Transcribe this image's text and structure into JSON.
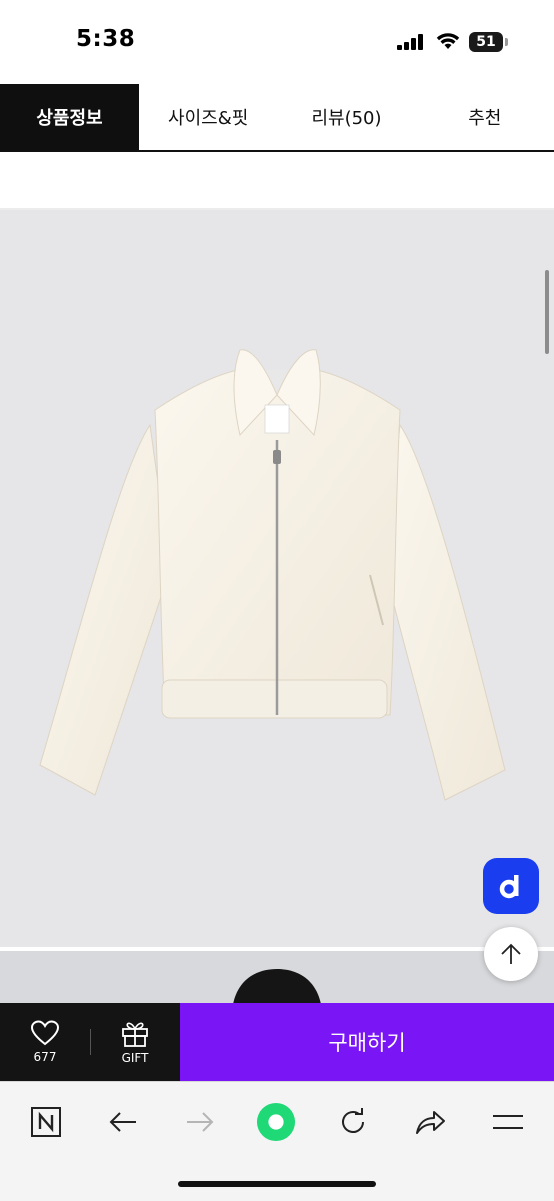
{
  "status_bar": {
    "time": "5:38",
    "battery": "51"
  },
  "tabs": [
    {
      "label": "상품정보",
      "active": true
    },
    {
      "label": "사이즈&핏",
      "active": false
    },
    {
      "label": "리뷰(50)",
      "active": false
    },
    {
      "label": "추천",
      "active": false
    }
  ],
  "product_image": {
    "description_icon": "white-cropped-zip-jacket"
  },
  "floating": {
    "brand_icon": "d-icon",
    "scroll_top_icon": "arrow-up-icon"
  },
  "buy_bar": {
    "wish_count": "677",
    "gift_label": "GIFT",
    "buy_label": "구매하기",
    "buy_color": "#7a16f5"
  },
  "browser_toolbar": {
    "icons": [
      "n-logo-icon",
      "back-arrow-icon",
      "forward-arrow-icon",
      "green-circle-icon",
      "reload-icon",
      "share-icon",
      "menu-icon"
    ]
  }
}
